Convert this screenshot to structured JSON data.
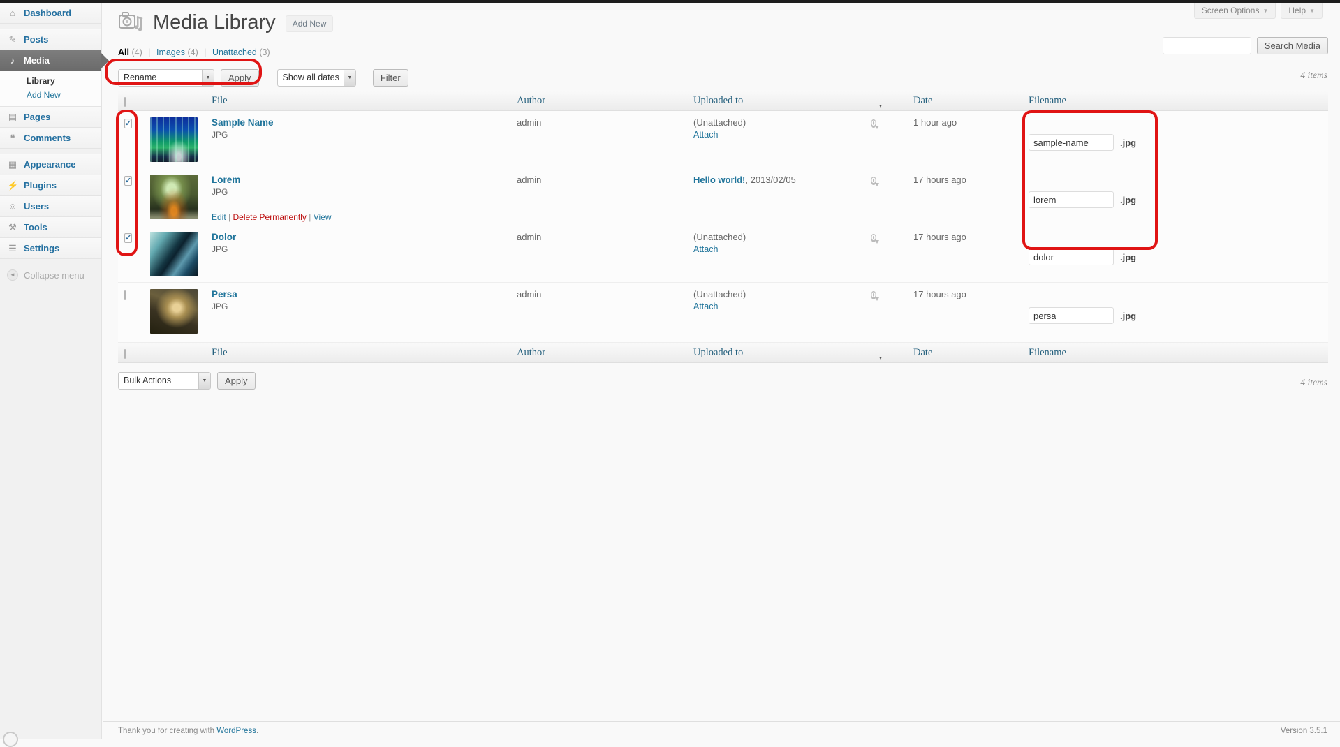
{
  "colors": {
    "annotation_red": "#e01414",
    "link_blue": "#21759B",
    "delete_red": "#BC0B0B",
    "active_menu_gray": "#6f6f6f"
  },
  "icons": {
    "chevron_down": "▼",
    "collapse_arrow": "◄",
    "check": "✓"
  },
  "sidebar": {
    "items": [
      {
        "label": "Dashboard",
        "icon": "⌂"
      },
      {
        "label": "Posts",
        "icon": "✎"
      },
      {
        "label": "Media",
        "icon": "♪"
      },
      {
        "label": "Pages",
        "icon": "▤"
      },
      {
        "label": "Comments",
        "icon": "❝"
      },
      {
        "label": "Appearance",
        "icon": "▦"
      },
      {
        "label": "Plugins",
        "icon": "⚡"
      },
      {
        "label": "Users",
        "icon": "☺"
      },
      {
        "label": "Tools",
        "icon": "⚒"
      },
      {
        "label": "Settings",
        "icon": "☰"
      }
    ],
    "submenu": {
      "library": "Library",
      "add_new": "Add New"
    },
    "collapse_label": "Collapse menu"
  },
  "header": {
    "title": "Media Library",
    "add_new": "Add New",
    "screen_options": "Screen Options",
    "help": "Help"
  },
  "search": {
    "value": "",
    "button": "Search Media"
  },
  "filters": {
    "all": "All",
    "all_count": "(4)",
    "images": "Images",
    "images_count": "(4)",
    "unattached": "Unattached",
    "unattached_count": "(3)",
    "sep": "|"
  },
  "toolbar_top": {
    "bulk_select": "Rename",
    "apply": "Apply",
    "dates_select": "Show all dates",
    "filter": "Filter",
    "items_count": "4 items"
  },
  "toolbar_bottom": {
    "bulk_select": "Bulk Actions",
    "apply": "Apply",
    "items_count": "4 items"
  },
  "table": {
    "headers": {
      "file": "File",
      "author": "Author",
      "uploaded_to": "Uploaded to",
      "date": "Date",
      "filename": "Filename"
    },
    "rows": [
      {
        "check": "✓",
        "title": "Sample Name",
        "type": "JPG",
        "author": "admin",
        "uploaded_to": "(Unattached)",
        "attach": "Attach",
        "comments": "0",
        "date": "1 hour ago",
        "filename": "sample-name",
        "ext": ".jpg"
      },
      {
        "check": "✓",
        "title": "Lorem",
        "type": "JPG",
        "author": "admin",
        "uploaded_link": "Hello world!",
        "uploaded_suffix": ", 2013/02/05",
        "comments": "0",
        "date": "17 hours ago",
        "filename": "lorem",
        "ext": ".jpg",
        "actions": {
          "edit": "Edit",
          "sep1": "|",
          "delete": "Delete Permanently",
          "sep2": "|",
          "view": "View"
        }
      },
      {
        "check": "✓",
        "title": "Dolor",
        "type": "JPG",
        "author": "admin",
        "uploaded_to": "(Unattached)",
        "attach": "Attach",
        "comments": "0",
        "date": "17 hours ago",
        "filename": "dolor",
        "ext": ".jpg"
      },
      {
        "check": "",
        "title": "Persa",
        "type": "JPG",
        "author": "admin",
        "uploaded_to": "(Unattached)",
        "attach": "Attach",
        "comments": "0",
        "date": "17 hours ago",
        "filename": "persa",
        "ext": ".jpg"
      }
    ]
  },
  "footer": {
    "thanks": "Thank you for creating with",
    "wordpress_link": "WordPress",
    "period": ".",
    "version": "Version 3.5.1"
  }
}
